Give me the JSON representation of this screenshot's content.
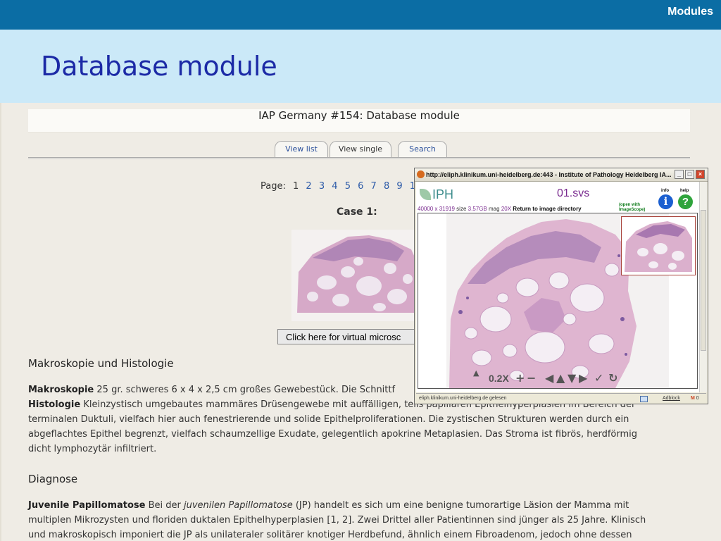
{
  "slide": {
    "section": "Modules",
    "title": "Database module"
  },
  "page": {
    "heading": "IAP Germany #154: Database module",
    "tabs": [
      "View list",
      "View single",
      "Search"
    ],
    "pager": {
      "label": "Page:",
      "current": "1",
      "links": [
        "2",
        "3",
        "4",
        "5",
        "6",
        "7",
        "8",
        "9",
        "1"
      ]
    },
    "case_title": "Case 1:",
    "virtual_button": "Click here for virtual microsc",
    "sections": {
      "makro_heading": "Makroskopie und Histologie",
      "makro_label": "Makroskopie",
      "makro_text": "25 gr. schweres 6 x 4 x 2,5 cm großes Gewebestück. Die Schnittf",
      "histo_label": "Histologie",
      "histo_text": "Kleinzystisch umgebautes mammäres Drüsengewebe mit auffälligen, teils papillären Epithelhyperplasien im Bereich der",
      "histo_line2": "terminalen Duktuli, vielfach hier auch fenestrierende und solide Epithelproliferationen. Die zystischen Strukturen werden durch ein",
      "histo_line3": "abgeflachtes Epithel begrenzt, vielfach schaumzellige Exudate, gelegentlich apokrine Metaplasien. Das Stroma ist fibrös, herdförmig",
      "histo_line4": "dicht lymphozytär infiltriert.",
      "diag_heading": "Diagnose",
      "diag_label": "Juvenile Papillomatose",
      "diag_pre": "Bei der",
      "diag_italic": "juvenilen Papillomatose",
      "diag_post": "(JP) handelt es sich um eine benigne tumorartige Läsion der Mamma mit",
      "diag_line2": "multiplen Mikrozysten und floriden duktalen Epithelhyperplasien [1, 2]. Zwei Drittel aller Patientinnen sind jünger als 25 Jahre. Klinisch",
      "diag_line3": "und makroskopisch imponiert die JP als unilateraler solitärer knotiger Herdbefund, ähnlich einem Fibroadenom, jedoch ohne dessen"
    }
  },
  "popup": {
    "window_title": "http://eliph.klinikum.uni-heidelberg.de:443 - Institute of Pathology Heidelberg IA...",
    "logo": "IPH",
    "filename": "01.svs",
    "dims": "40000 x 31919",
    "size_label": "size",
    "size_value": "3.57GB",
    "mag_label": "mag",
    "mag_value": "20X",
    "return_link": "Return to image directory",
    "open_with_1": "(open with",
    "open_with_2": "ImageScope)",
    "info_label": "info",
    "help_label": "help",
    "zoom": "0.2X",
    "status": "eliph.klinikum.uni-heidelberg.de gelesen",
    "adblock": "Adblock",
    "gmail_count": "0"
  }
}
